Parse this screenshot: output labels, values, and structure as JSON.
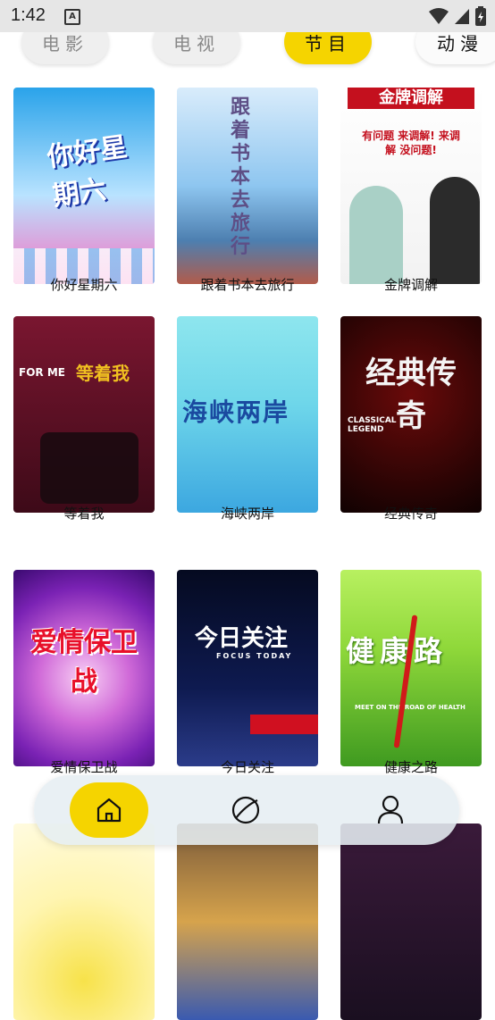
{
  "status_bar": {
    "time": "1:42",
    "notification_glyph": "A"
  },
  "tabs": [
    {
      "label": "电影",
      "active": false
    },
    {
      "label": "电视",
      "active": false
    },
    {
      "label": "节目",
      "active": true
    },
    {
      "label": "动漫",
      "active": false
    }
  ],
  "programs": [
    {
      "title": "你好星期六",
      "poster_text": "你好星期六",
      "colors": [
        "#2aa3ea",
        "#f66ec0"
      ]
    },
    {
      "title": "跟着书本去旅行",
      "poster_text": "跟着书本去旅行",
      "colors": [
        "#8ec6f0",
        "#c0dff5"
      ]
    },
    {
      "title": "金牌调解",
      "poster_text": "金牌调解",
      "sub_text": "有问题 来调解! 来调解 没问题!",
      "colors": [
        "#ffffff",
        "#e8e8e8"
      ]
    },
    {
      "title": "等着我",
      "poster_text": "等着我",
      "sub_text": "FOR ME",
      "colors": [
        "#7a1630",
        "#3d0a18"
      ]
    },
    {
      "title": "海峡两岸",
      "poster_text": "海峡两岸",
      "colors": [
        "#6ed6ea",
        "#3ca7e0"
      ]
    },
    {
      "title": "经典传奇",
      "poster_text": "经典传奇",
      "sub_text": "CLASSICAL LEGEND",
      "colors": [
        "#5a0808",
        "#1b0404"
      ]
    },
    {
      "title": "爱情保卫战",
      "poster_text": "爱情保卫战",
      "colors": [
        "#b73ad0",
        "#5a1aa0"
      ]
    },
    {
      "title": "今日关注",
      "poster_text": "今日关注",
      "sub_text": "FOCUS TODAY",
      "colors": [
        "#0a1238",
        "#1d2f7a"
      ]
    },
    {
      "title": "健康之路",
      "poster_text": "健康路",
      "sub_text": "MEET ON THE ROAD OF HEALTH",
      "colors": [
        "#8fd83a",
        "#3f9a20"
      ]
    },
    {
      "title": "",
      "poster_text": "",
      "colors": [
        "#f7e24a",
        "#fffbe0"
      ]
    },
    {
      "title": "",
      "poster_text": "",
      "colors": [
        "#d6a34c",
        "#5a3c2a"
      ]
    },
    {
      "title": "",
      "poster_text": "",
      "colors": [
        "#3a1a3a",
        "#1a0f20"
      ]
    }
  ],
  "bottom_nav": [
    {
      "icon": "home-icon",
      "active": true
    },
    {
      "icon": "planet-icon",
      "active": false
    },
    {
      "icon": "user-icon",
      "active": false
    }
  ]
}
